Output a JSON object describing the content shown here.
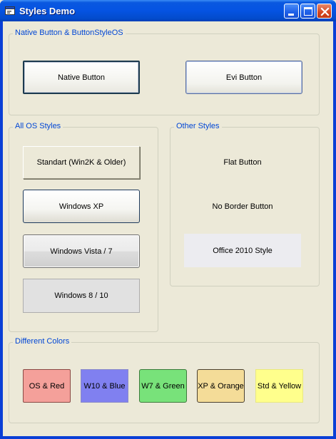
{
  "window": {
    "title": "Styles Demo"
  },
  "groups": {
    "native": {
      "label": "Native Button & ButtonStyleOS",
      "native_button": "Native Button",
      "evi_button": "Evi Button"
    },
    "os_styles": {
      "label": "All OS Styles",
      "buttons": [
        "Standart (Win2K & Older)",
        "Windows XP",
        "Windows Vista / 7",
        "Windows 8 / 10"
      ]
    },
    "other_styles": {
      "label": "Other Styles",
      "buttons": [
        "Flat Button",
        "No Border Button",
        "Office 2010 Style"
      ]
    },
    "colors": {
      "label": "Different Colors",
      "buttons": [
        {
          "label": "OS & Red",
          "color": "#f4a09a"
        },
        {
          "label": "W10 & Blue",
          "color": "#8080f0"
        },
        {
          "label": "W7 & Green",
          "color": "#78e27a"
        },
        {
          "label": "XP & Orange",
          "color": "#f4dc98"
        },
        {
          "label": "Std & Yellow",
          "color": "#ffff8c"
        }
      ]
    }
  },
  "colors": {
    "group_label": "#0046d5",
    "title_bar": "#0553e2",
    "face": "#ece9d8"
  }
}
